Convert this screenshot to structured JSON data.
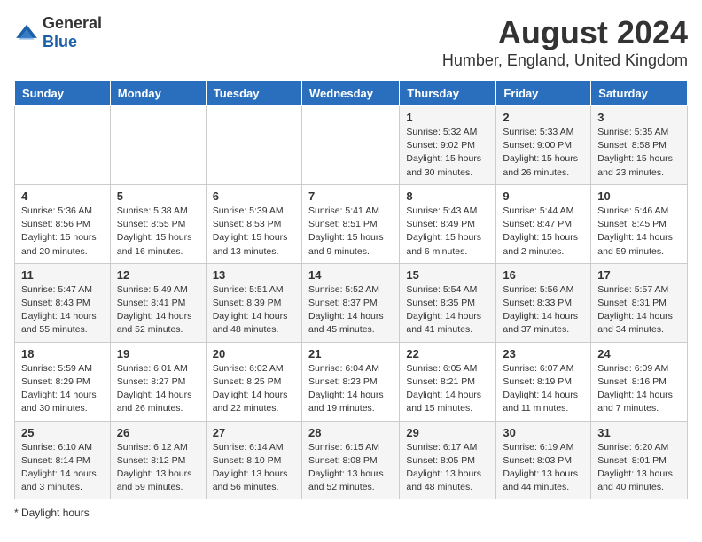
{
  "header": {
    "logo_general": "General",
    "logo_blue": "Blue",
    "title": "August 2024",
    "subtitle": "Humber, England, United Kingdom"
  },
  "columns": [
    "Sunday",
    "Monday",
    "Tuesday",
    "Wednesday",
    "Thursday",
    "Friday",
    "Saturday"
  ],
  "weeks": [
    [
      {
        "date": "",
        "info": ""
      },
      {
        "date": "",
        "info": ""
      },
      {
        "date": "",
        "info": ""
      },
      {
        "date": "",
        "info": ""
      },
      {
        "date": "1",
        "info": "Sunrise: 5:32 AM\nSunset: 9:02 PM\nDaylight: 15 hours and 30 minutes."
      },
      {
        "date": "2",
        "info": "Sunrise: 5:33 AM\nSunset: 9:00 PM\nDaylight: 15 hours and 26 minutes."
      },
      {
        "date": "3",
        "info": "Sunrise: 5:35 AM\nSunset: 8:58 PM\nDaylight: 15 hours and 23 minutes."
      }
    ],
    [
      {
        "date": "4",
        "info": "Sunrise: 5:36 AM\nSunset: 8:56 PM\nDaylight: 15 hours and 20 minutes."
      },
      {
        "date": "5",
        "info": "Sunrise: 5:38 AM\nSunset: 8:55 PM\nDaylight: 15 hours and 16 minutes."
      },
      {
        "date": "6",
        "info": "Sunrise: 5:39 AM\nSunset: 8:53 PM\nDaylight: 15 hours and 13 minutes."
      },
      {
        "date": "7",
        "info": "Sunrise: 5:41 AM\nSunset: 8:51 PM\nDaylight: 15 hours and 9 minutes."
      },
      {
        "date": "8",
        "info": "Sunrise: 5:43 AM\nSunset: 8:49 PM\nDaylight: 15 hours and 6 minutes."
      },
      {
        "date": "9",
        "info": "Sunrise: 5:44 AM\nSunset: 8:47 PM\nDaylight: 15 hours and 2 minutes."
      },
      {
        "date": "10",
        "info": "Sunrise: 5:46 AM\nSunset: 8:45 PM\nDaylight: 14 hours and 59 minutes."
      }
    ],
    [
      {
        "date": "11",
        "info": "Sunrise: 5:47 AM\nSunset: 8:43 PM\nDaylight: 14 hours and 55 minutes."
      },
      {
        "date": "12",
        "info": "Sunrise: 5:49 AM\nSunset: 8:41 PM\nDaylight: 14 hours and 52 minutes."
      },
      {
        "date": "13",
        "info": "Sunrise: 5:51 AM\nSunset: 8:39 PM\nDaylight: 14 hours and 48 minutes."
      },
      {
        "date": "14",
        "info": "Sunrise: 5:52 AM\nSunset: 8:37 PM\nDaylight: 14 hours and 45 minutes."
      },
      {
        "date": "15",
        "info": "Sunrise: 5:54 AM\nSunset: 8:35 PM\nDaylight: 14 hours and 41 minutes."
      },
      {
        "date": "16",
        "info": "Sunrise: 5:56 AM\nSunset: 8:33 PM\nDaylight: 14 hours and 37 minutes."
      },
      {
        "date": "17",
        "info": "Sunrise: 5:57 AM\nSunset: 8:31 PM\nDaylight: 14 hours and 34 minutes."
      }
    ],
    [
      {
        "date": "18",
        "info": "Sunrise: 5:59 AM\nSunset: 8:29 PM\nDaylight: 14 hours and 30 minutes."
      },
      {
        "date": "19",
        "info": "Sunrise: 6:01 AM\nSunset: 8:27 PM\nDaylight: 14 hours and 26 minutes."
      },
      {
        "date": "20",
        "info": "Sunrise: 6:02 AM\nSunset: 8:25 PM\nDaylight: 14 hours and 22 minutes."
      },
      {
        "date": "21",
        "info": "Sunrise: 6:04 AM\nSunset: 8:23 PM\nDaylight: 14 hours and 19 minutes."
      },
      {
        "date": "22",
        "info": "Sunrise: 6:05 AM\nSunset: 8:21 PM\nDaylight: 14 hours and 15 minutes."
      },
      {
        "date": "23",
        "info": "Sunrise: 6:07 AM\nSunset: 8:19 PM\nDaylight: 14 hours and 11 minutes."
      },
      {
        "date": "24",
        "info": "Sunrise: 6:09 AM\nSunset: 8:16 PM\nDaylight: 14 hours and 7 minutes."
      }
    ],
    [
      {
        "date": "25",
        "info": "Sunrise: 6:10 AM\nSunset: 8:14 PM\nDaylight: 14 hours and 3 minutes."
      },
      {
        "date": "26",
        "info": "Sunrise: 6:12 AM\nSunset: 8:12 PM\nDaylight: 13 hours and 59 minutes."
      },
      {
        "date": "27",
        "info": "Sunrise: 6:14 AM\nSunset: 8:10 PM\nDaylight: 13 hours and 56 minutes."
      },
      {
        "date": "28",
        "info": "Sunrise: 6:15 AM\nSunset: 8:08 PM\nDaylight: 13 hours and 52 minutes."
      },
      {
        "date": "29",
        "info": "Sunrise: 6:17 AM\nSunset: 8:05 PM\nDaylight: 13 hours and 48 minutes."
      },
      {
        "date": "30",
        "info": "Sunrise: 6:19 AM\nSunset: 8:03 PM\nDaylight: 13 hours and 44 minutes."
      },
      {
        "date": "31",
        "info": "Sunrise: 6:20 AM\nSunset: 8:01 PM\nDaylight: 13 hours and 40 minutes."
      }
    ]
  ],
  "footer": {
    "note": "Daylight hours"
  }
}
